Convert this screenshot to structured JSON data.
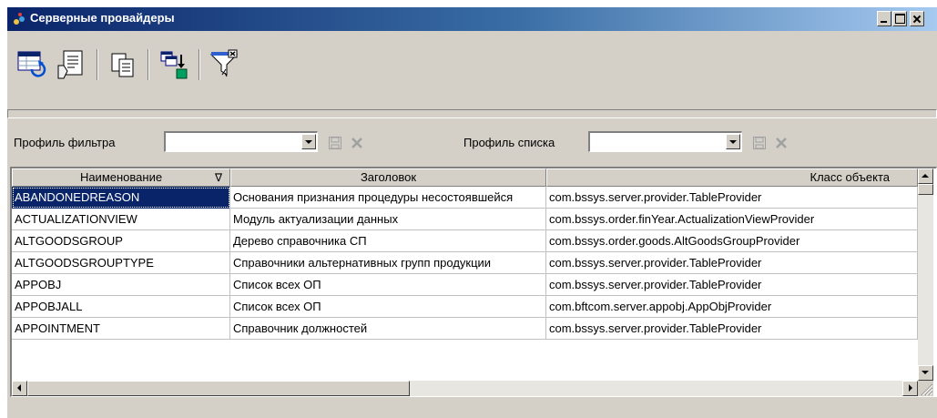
{
  "window": {
    "title": "Серверные провайдеры"
  },
  "toolbar": {
    "buttons": [
      {
        "icon": "refresh-table-icon"
      },
      {
        "icon": "edit-document-icon"
      },
      {
        "icon": "copy-icon"
      },
      {
        "icon": "export-windows-icon"
      },
      {
        "icon": "filter-icon"
      }
    ]
  },
  "filter": {
    "filter_profile_label": "Профиль фильтра",
    "filter_profile_value": "",
    "list_profile_label": "Профиль списка",
    "list_profile_value": ""
  },
  "grid": {
    "columns": [
      {
        "label": "Наименование",
        "sort_marker": "∇"
      },
      {
        "label": "Заголовок"
      },
      {
        "label": "Класс объекта"
      }
    ],
    "rows": [
      {
        "name": "ABANDONEDREASON",
        "caption": "Основания признания процедуры несостоявшейся",
        "class": "com.bssys.server.provider.TableProvider",
        "selected": true
      },
      {
        "name": "ACTUALIZATIONVIEW",
        "caption": "Модуль актуализации данных",
        "class": "com.bssys.order.finYear.ActualizationViewProvider"
      },
      {
        "name": "ALTGOODSGROUP",
        "caption": "Дерево справочника СП",
        "class": "com.bssys.order.goods.AltGoodsGroupProvider"
      },
      {
        "name": "ALTGOODSGROUPTYPE",
        "caption": "Справочники альтернативных групп продукции",
        "class": "com.bssys.server.provider.TableProvider"
      },
      {
        "name": "APPOBJ",
        "caption": "Список всех ОП",
        "class": "com.bssys.server.provider.TableProvider"
      },
      {
        "name": "APPOBJALL",
        "caption": "Список всех ОП",
        "class": "com.bftcom.server.appobj.AppObjProvider"
      },
      {
        "name": "APPOINTMENT",
        "caption": "Справочник должностей",
        "class": "com.bssys.server.provider.TableProvider"
      }
    ]
  },
  "colors": {
    "title_start": "#0a246a",
    "title_end": "#a6caf0",
    "face": "#d4d0c8",
    "selection": "#0a246a"
  }
}
